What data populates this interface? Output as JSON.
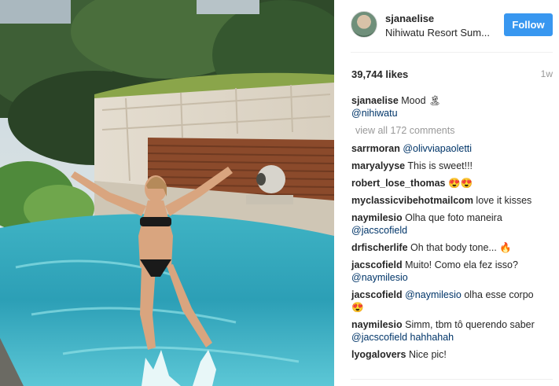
{
  "post": {
    "username": "sjanaelise",
    "location": "Nihiwatu Resort Sum...",
    "follow_label": "Follow",
    "likes": "39,744 likes",
    "age": "1w"
  },
  "caption": {
    "username": "sjanaelise",
    "text": "Mood 🏝",
    "mention": "@nihiwatu"
  },
  "view_all": "view all 172 comments",
  "comments": [
    {
      "user": "sarrmoran",
      "mention": "@olivviapaoletti",
      "text": ""
    },
    {
      "user": "maryalyyse",
      "mention": "",
      "text": "This is sweet!!!"
    },
    {
      "user": "robert_lose_thomas",
      "mention": "",
      "text": "😍😍"
    },
    {
      "user": "myclassicvibehotmailcom",
      "mention": "",
      "text": "love it kisses"
    },
    {
      "user": "naymilesio",
      "mention": "",
      "text": "Olha que foto maneira",
      "tail": "@jacscofield"
    },
    {
      "user": "drfischerlife",
      "mention": "",
      "text": "Oh that body tone... 🔥"
    },
    {
      "user": "jacscofield",
      "mention": "",
      "text": "Muito! Como ela fez isso?",
      "tail": "@naymilesio"
    },
    {
      "user": "jacscofield",
      "mention": "@naymilesio",
      "text": "olha esse corpo",
      "tail": "😍"
    },
    {
      "user": "naymilesio",
      "mention": "",
      "text": "Simm, tbm tô querendo saber",
      "tail": "@jacscofield hahhahah"
    },
    {
      "user": "lyogalovers",
      "mention": "",
      "text": "Nice pic!"
    }
  ],
  "colors": {
    "follow_bg": "#3897f0",
    "mention": "#003569",
    "muted": "#999999"
  },
  "icons": {
    "avatar": "profile-photo"
  }
}
